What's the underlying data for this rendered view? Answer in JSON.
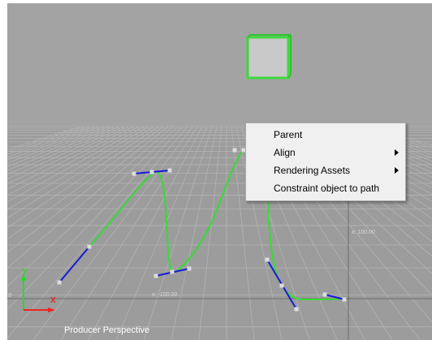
{
  "viewport": {
    "name": "Producer Perspective",
    "bg_color": "#9c9c9c",
    "grid_labels": {
      "left_ruler": "x: -100.00",
      "right_ruler": "x: 100.00",
      "far_left": "0"
    },
    "gizmo": {
      "x_label": "X",
      "y_label": "Y"
    },
    "colors": {
      "path": "#33dd33",
      "tangent": "#1a1ad8",
      "handle": "#dddddd",
      "selection": "#3ed83e",
      "axis_x": "#ee2222",
      "axis_y": "#22dd22"
    }
  },
  "context_menu": {
    "items": [
      {
        "label": "Parent",
        "submenu": false
      },
      {
        "label": "Align",
        "submenu": true
      },
      {
        "label": "Rendering Assets",
        "submenu": true
      },
      {
        "label": "Constraint object to path",
        "submenu": false
      }
    ]
  }
}
